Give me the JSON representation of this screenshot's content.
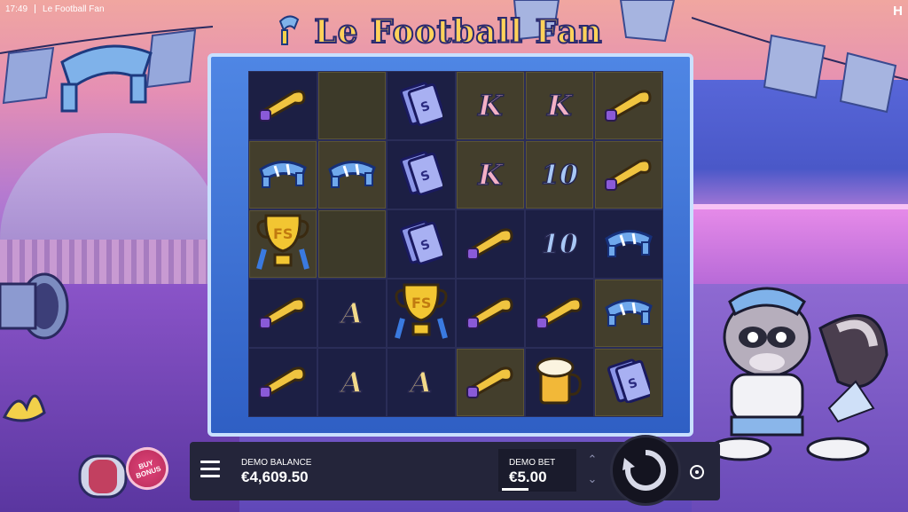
{
  "status": {
    "time": "17:49",
    "app_title": "Le Football Fan",
    "corner_glyph": "H"
  },
  "game": {
    "logo_text": "Le Football Fan"
  },
  "reels": [
    [
      {
        "sym": "horn-icon",
        "win": false,
        "empty": true
      },
      {
        "sym": "blank",
        "win": true,
        "empty": true
      },
      {
        "sym": "ticket-icon",
        "win": false
      },
      {
        "sym": "K",
        "win": true
      },
      {
        "sym": "K",
        "win": true
      },
      {
        "sym": "horn-icon",
        "win": true
      }
    ],
    [
      {
        "sym": "scarf-icon",
        "win": true
      },
      {
        "sym": "scarf-icon",
        "win": true
      },
      {
        "sym": "ticket-icon",
        "win": false
      },
      {
        "sym": "K",
        "win": true
      },
      {
        "sym": "10",
        "win": true
      },
      {
        "sym": "horn-icon",
        "win": true
      }
    ],
    [
      {
        "sym": "trophy-icon",
        "win": true
      },
      {
        "sym": "blank",
        "win": true,
        "empty": true
      },
      {
        "sym": "ticket-icon",
        "win": false
      },
      {
        "sym": "horn-icon",
        "win": false
      },
      {
        "sym": "10",
        "win": false
      },
      {
        "sym": "scarf-icon",
        "win": false
      }
    ],
    [
      {
        "sym": "horn-icon",
        "win": false
      },
      {
        "sym": "A",
        "win": false
      },
      {
        "sym": "trophy-icon",
        "win": false
      },
      {
        "sym": "horn-icon",
        "win": false
      },
      {
        "sym": "horn-icon",
        "win": false
      },
      {
        "sym": "scarf-icon",
        "win": true
      }
    ],
    [
      {
        "sym": "horn-icon",
        "win": false
      },
      {
        "sym": "A",
        "win": false
      },
      {
        "sym": "A",
        "win": false
      },
      {
        "sym": "horn-icon",
        "win": true
      },
      {
        "sym": "beer-icon",
        "win": false
      },
      {
        "sym": "ticket-icon",
        "win": true
      }
    ]
  ],
  "balance": {
    "label": "DEMO BALANCE",
    "value": "€4,609.50"
  },
  "bet": {
    "label": "DEMO BET",
    "value": "€5.00",
    "up": "⌃",
    "down": "⌄"
  },
  "buy_bonus": {
    "line1": "BUY",
    "line2": "BONUS"
  },
  "colors": {
    "reel_bg": "#1c1f44",
    "frame_blue": "#2f5fc4",
    "win_cell": "#433e2c",
    "bar_bg": "#24253a"
  }
}
